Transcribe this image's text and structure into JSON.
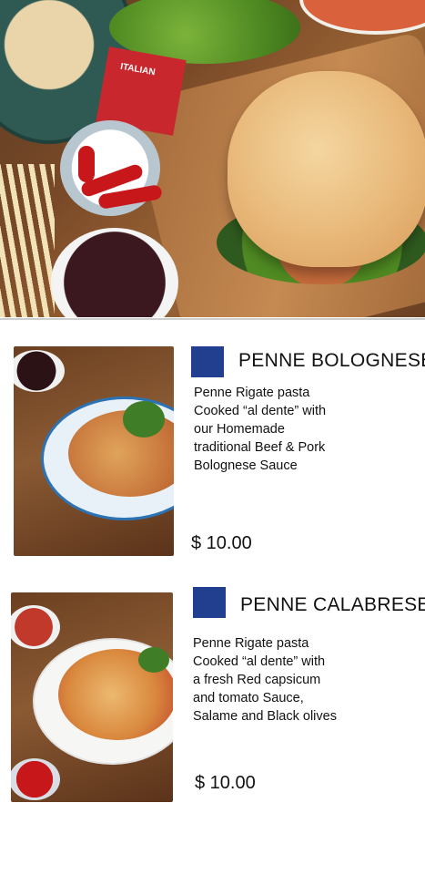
{
  "hero": {
    "tag_text": "ITALIAN"
  },
  "items": [
    {
      "title": "PENNE BOLOGNESE",
      "description": "Penne Rigate pasta\nCooked “al dente” with\nour Homemade\ntraditional Beef & Pork\nBolognese Sauce",
      "price": "$ 10.00",
      "accent_color": "#223f8f",
      "image_icon": "pasta-bolognese-photo"
    },
    {
      "title": "PENNE CALABRESE",
      "description": "Penne Rigate pasta\nCooked “al dente” with\na fresh Red capsicum\nand tomato Sauce,\nSalame and Black olives",
      "price": "$ 10.00",
      "accent_color": "#223f8f",
      "image_icon": "pasta-calabrese-photo"
    }
  ]
}
